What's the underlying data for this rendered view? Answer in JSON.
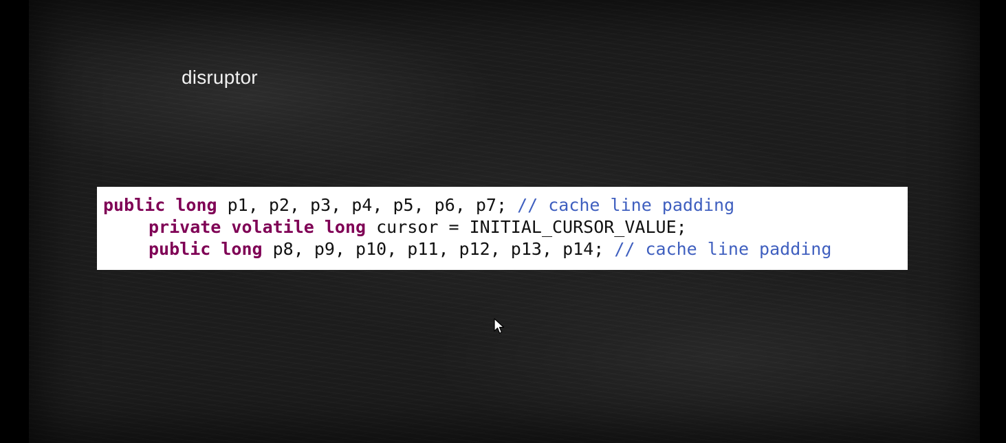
{
  "slide": {
    "title": "disruptor"
  },
  "code": {
    "lines": [
      {
        "keyword": "public long",
        "text": " p1, p2, p3, p4, p5, p6, p7; ",
        "comment": "// cache line padding"
      },
      {
        "keyword": "private volatile long",
        "text": " cursor = INITIAL_CURSOR_VALUE;",
        "comment": ""
      },
      {
        "keyword": "public long",
        "text": " p8, p9, p10, p11, p12, p13, p14; ",
        "comment": "// cache line padding"
      }
    ]
  },
  "colors": {
    "keyword": "#7f0055",
    "comment": "#3f5fbf",
    "background": "#1c1c1c",
    "code_background": "#ffffff"
  },
  "icons": {
    "pointer": "mouse-pointer-icon"
  }
}
